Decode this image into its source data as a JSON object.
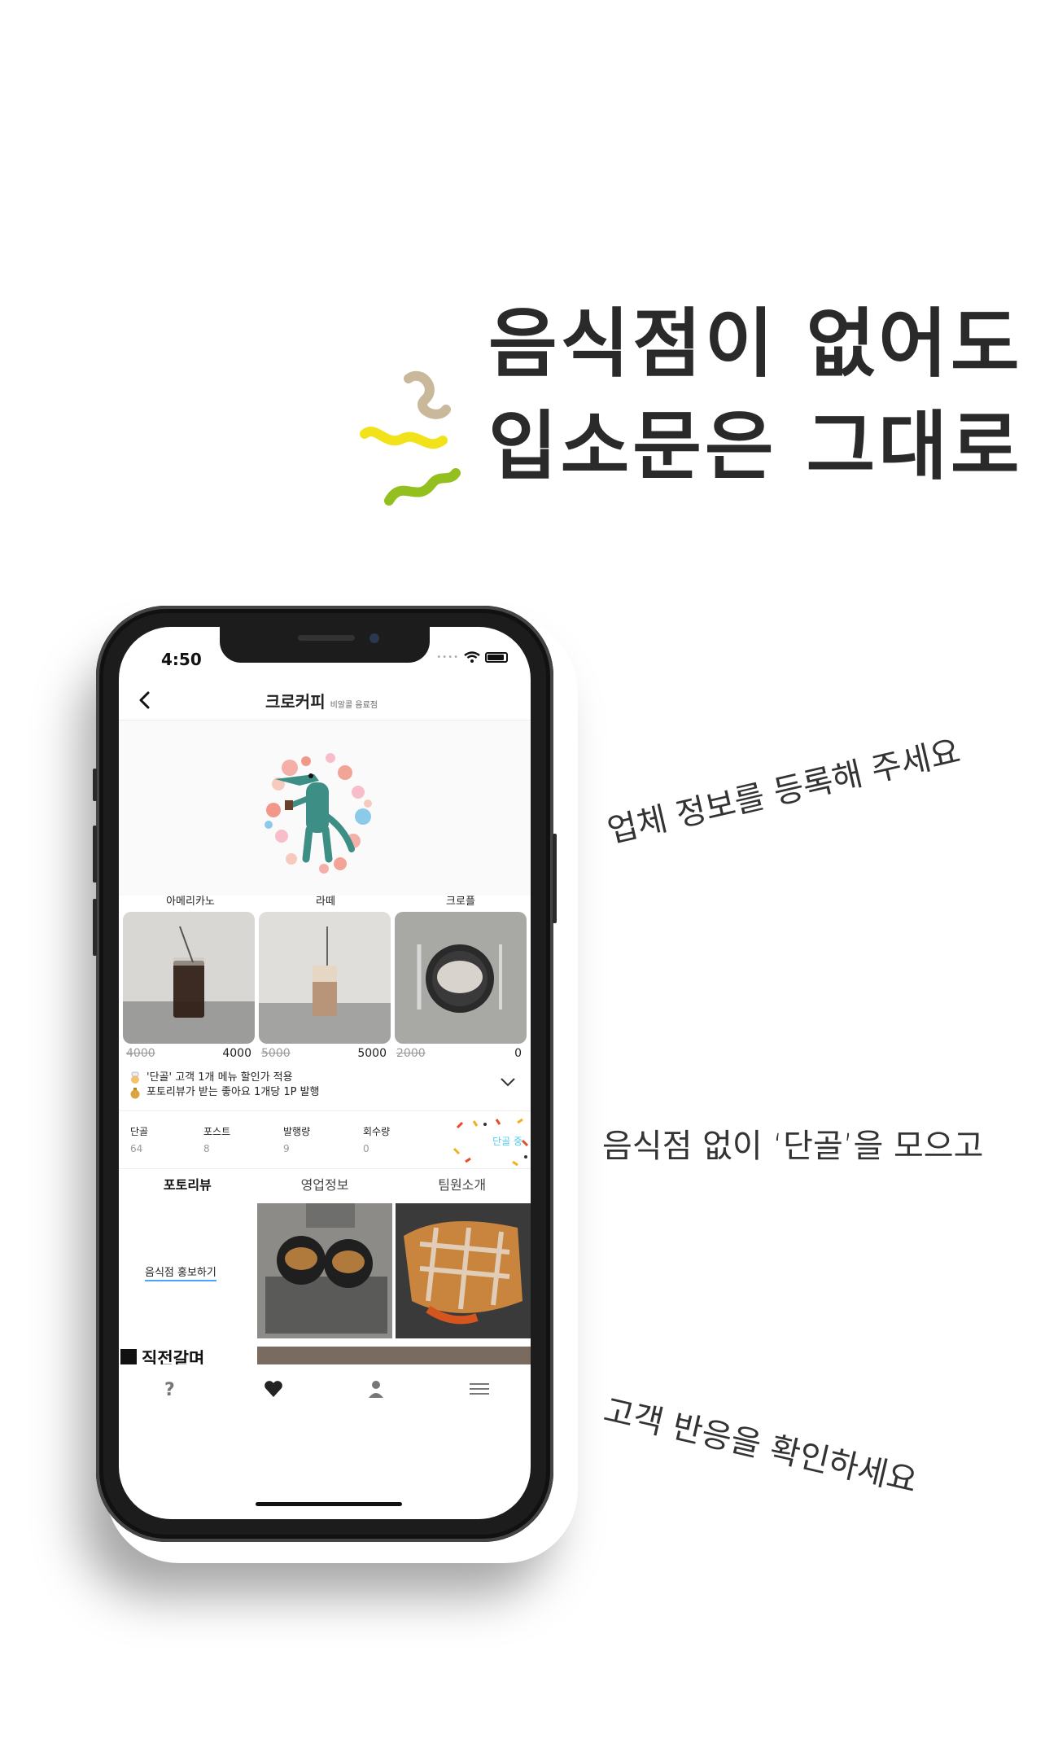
{
  "headline": {
    "line1": "음식점이 없어도",
    "line2": "입소문은 그대로"
  },
  "captions": {
    "register": "업체 정보를 등록해 주세요",
    "gather": "음식점 없이 ‘단골’을 모으고",
    "check": "고객 반응을 확인하세요"
  },
  "status_bar": {
    "time": "4:50"
  },
  "nav": {
    "title": "크로커피",
    "subtitle": "비알콜 음료점"
  },
  "products": [
    {
      "name": "아메리카노",
      "old_price": "4000",
      "price": "4000"
    },
    {
      "name": "라떼",
      "old_price": "5000",
      "price": "5000"
    },
    {
      "name": "크로플",
      "old_price": "2000",
      "price": "0"
    }
  ],
  "benefits": {
    "line1": "'단골' 고객 1개 메뉴 할인가 적용",
    "line2": "포토리뷰가 받는 좋아요 1개당 1P 발행"
  },
  "stats": [
    {
      "label": "단골",
      "value": "64"
    },
    {
      "label": "포스트",
      "value": "8"
    },
    {
      "label": "발행량",
      "value": "9"
    },
    {
      "label": "회수량",
      "value": "0"
    }
  ],
  "badge": "단골 중",
  "tabs": [
    "포토리뷰",
    "영업정보",
    "팀원소개"
  ],
  "promo_link": "음식점 홍보하기",
  "banner": "직전갈며",
  "colors": {
    "accent_link": "#4aa3ff",
    "badge": "#4ecdf0",
    "headline": "#2a2a2a",
    "squiggle_yellow": "#f2e21a",
    "squiggle_green": "#93c01f",
    "squiggle_tan": "#c9b89a"
  },
  "icons": [
    "back-icon",
    "wifi-icon",
    "battery-icon",
    "chevron-down-icon",
    "question-icon",
    "heart-icon",
    "person-icon",
    "menu-icon"
  ]
}
